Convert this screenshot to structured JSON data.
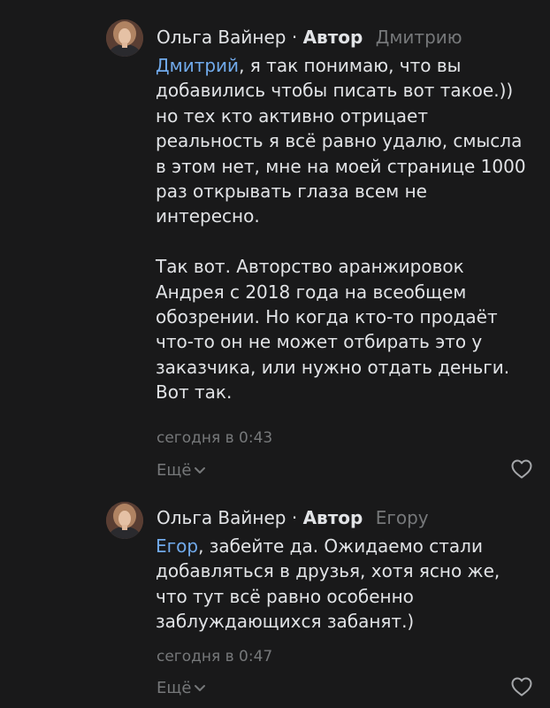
{
  "comments": [
    {
      "author": "Ольга Вайнер",
      "separator": "·",
      "role": "Автор",
      "reply_to": "Дмитрию",
      "mention": "Дмитрий",
      "text": ", я так понимаю, что вы добавились чтобы писать вот такое.)) но тех кто активно отрицает реальность я всё равно удалю, смысла в этом нет, мне на моей странице 1000 раз открывать глаза всем не интересно.\n\nТак вот. Авторство аранжировок Андрея с 2018 года на всеобщем обозрении. Но когда кто-то продаёт что-то он не может отбирать это у заказчика, или нужно отдать деньги. Вот так.",
      "timestamp": "сегодня в 0:43",
      "more_label": "Ещё",
      "like_icon": "heart-outline-icon"
    },
    {
      "author": "Ольга Вайнер",
      "separator": "·",
      "role": "Автор",
      "reply_to": "Егору",
      "mention": "Егор",
      "text": ", забейте да. Ожидаемо стали добавляться в друзья, хотя ясно же, что тут всё равно особенно заблуждающихся забанят.)",
      "timestamp": "сегодня в 0:47",
      "more_label": "Ещё",
      "like_icon": "heart-outline-icon"
    }
  ],
  "colors": {
    "background": "#19191a",
    "text": "#e1e3e6",
    "secondary": "#76787a",
    "link": "#71aaeb"
  }
}
